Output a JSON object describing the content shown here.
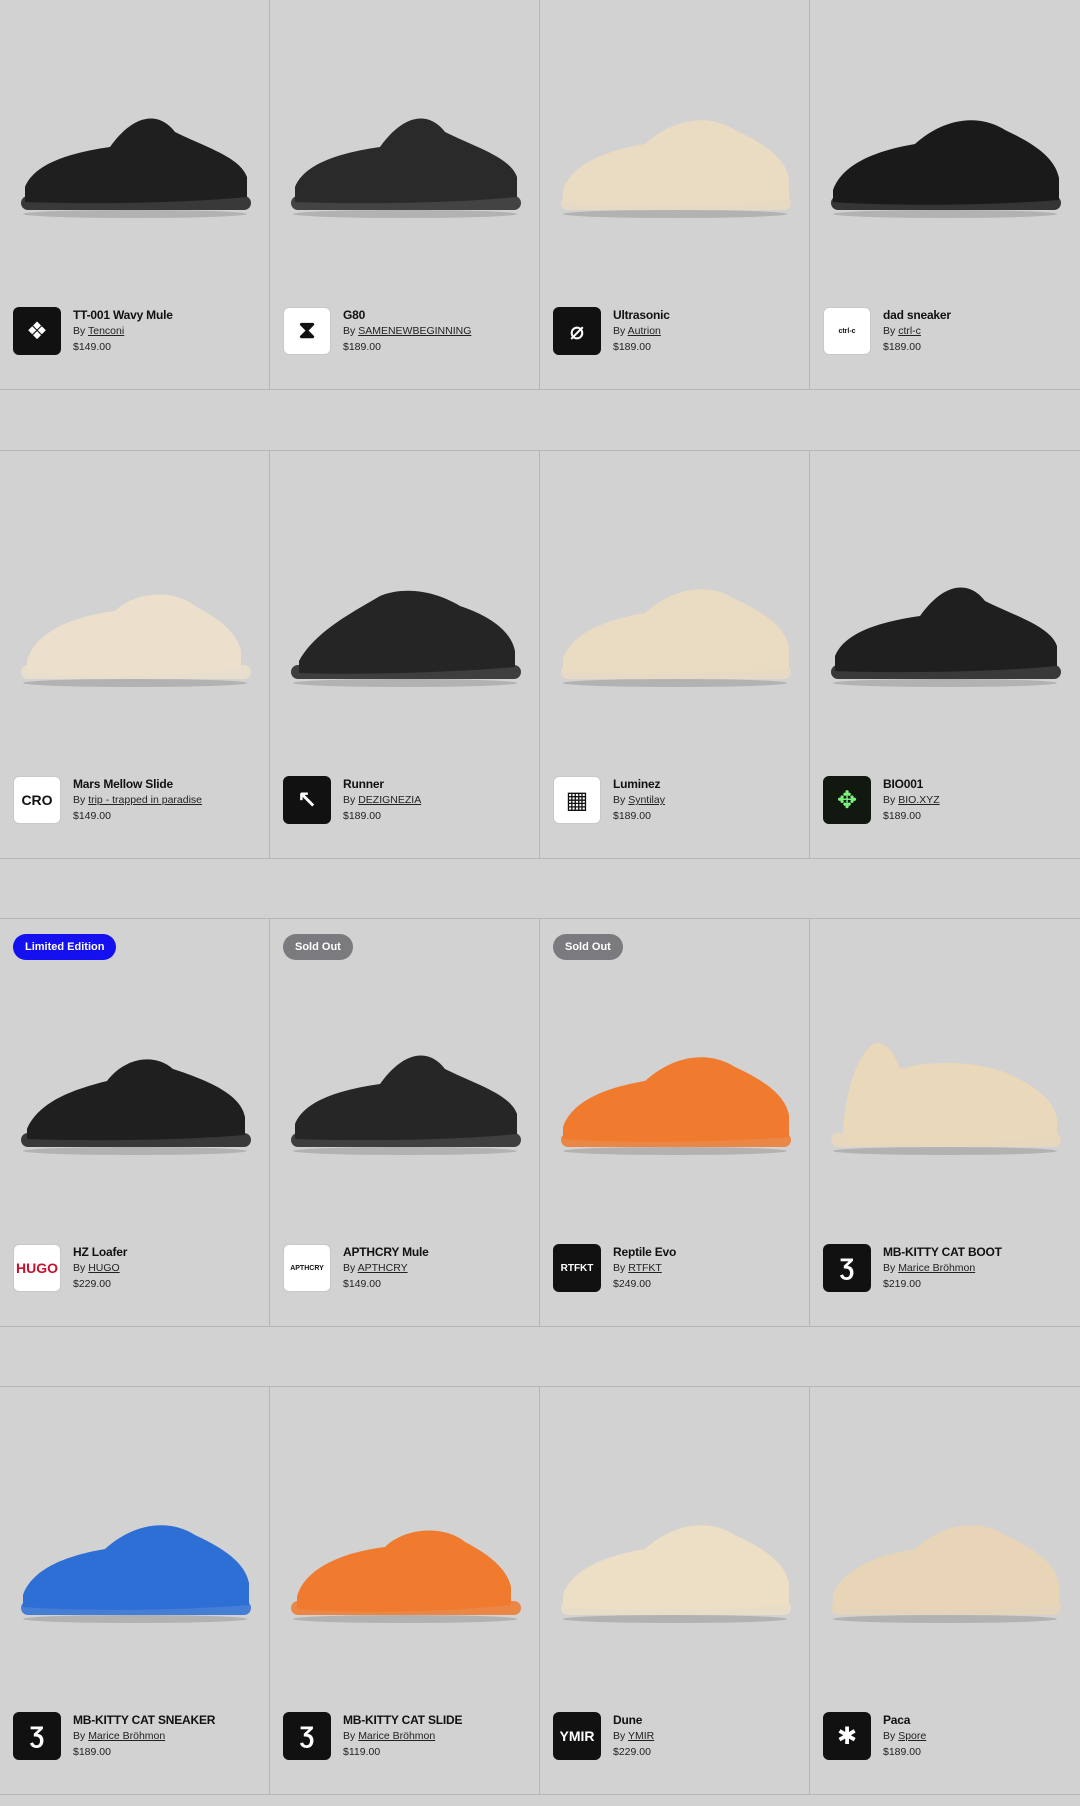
{
  "products": [
    {
      "title": "TT-001 Wavy Mule",
      "by": "By",
      "brand": "Tenconi",
      "price": "$149.00",
      "badge": "",
      "logo_text": "",
      "logo_icon": "tenconi-logo-icon",
      "logo_style": "dark",
      "color": "#1f1f1f",
      "shape": "mule"
    },
    {
      "title": "G80",
      "by": "By",
      "brand": "SAMENEWBEGINNING",
      "price": "$189.00",
      "badge": "",
      "logo_text": "",
      "logo_icon": "hourglass-logo-icon",
      "logo_style": "light",
      "color": "#2a2a2a",
      "shape": "mule"
    },
    {
      "title": "Ultrasonic",
      "by": "By",
      "brand": "Autrion",
      "price": "$189.00",
      "badge": "",
      "logo_text": "",
      "logo_icon": "autrion-logo-icon",
      "logo_style": "dark",
      "color": "#eadcc2",
      "shape": "sneaker"
    },
    {
      "title": "dad sneaker",
      "by": "By",
      "brand": "ctrl-c",
      "price": "$189.00",
      "badge": "",
      "logo_text": "ctrl-c",
      "logo_icon": "ctrl-c-logo-icon",
      "logo_style": "light",
      "color": "#1a1a1a",
      "shape": "sneaker"
    },
    {
      "title": "Mars Mellow Slide",
      "by": "By",
      "brand": "trip - trapped in paradise",
      "price": "$149.00",
      "badge": "",
      "logo_text": "CRO",
      "logo_icon": "cro-logo-icon",
      "logo_style": "light",
      "color": "#ece0cc",
      "shape": "slide"
    },
    {
      "title": "Runner",
      "by": "By",
      "brand": "DEZIGNEZIA",
      "price": "$189.00",
      "badge": "",
      "logo_text": "",
      "logo_icon": "cursor-logo-icon",
      "logo_style": "dark",
      "color": "#252525",
      "shape": "runner"
    },
    {
      "title": "Luminez",
      "by": "By",
      "brand": "Syntilay",
      "price": "$189.00",
      "badge": "",
      "logo_text": "",
      "logo_icon": "syntilay-logo-icon",
      "logo_style": "light",
      "color": "#eadcc2",
      "shape": "sneaker"
    },
    {
      "title": "BIO001",
      "by": "By",
      "brand": "BIO.XYZ",
      "price": "$189.00",
      "badge": "",
      "logo_text": "",
      "logo_icon": "bio-logo-icon",
      "logo_style": "green",
      "color": "#1f1f1f",
      "shape": "mule"
    },
    {
      "title": "HZ Loafer",
      "by": "By",
      "brand": "HUGO",
      "price": "$229.00",
      "badge": "Limited Edition",
      "badge_style": "limited",
      "logo_text": "HUGO",
      "logo_icon": "hugo-logo-icon",
      "logo_style": "light",
      "color": "#1f1f1f",
      "shape": "loafer"
    },
    {
      "title": "APTHCRY Mule",
      "by": "By",
      "brand": "APTHCRY",
      "price": "$149.00",
      "badge": "Sold Out",
      "badge_style": "sold",
      "logo_text": "APTHCRY",
      "logo_icon": "apthcry-logo-icon",
      "logo_style": "light",
      "color": "#262626",
      "shape": "mule"
    },
    {
      "title": "Reptile Evo",
      "by": "By",
      "brand": "RTFKT",
      "price": "$249.00",
      "badge": "Sold Out",
      "badge_style": "sold",
      "logo_text": "RTFKT",
      "logo_icon": "rtfkt-logo-icon",
      "logo_style": "dark",
      "color": "#f07a2e",
      "shape": "sneaker"
    },
    {
      "title": "MB-KITTY CAT BOOT",
      "by": "By",
      "brand": "Marice Bröhmon",
      "price": "$219.00",
      "badge": "",
      "logo_text": "",
      "logo_icon": "mb-logo-icon",
      "logo_style": "dark",
      "color": "#ead8bb",
      "shape": "boot"
    },
    {
      "title": "MB-KITTY CAT SNEAKER",
      "by": "By",
      "brand": "Marice Bröhmon",
      "price": "$189.00",
      "badge": "",
      "logo_text": "",
      "logo_icon": "mb-logo-icon",
      "logo_style": "dark",
      "color": "#2e6fd6",
      "shape": "sneaker"
    },
    {
      "title": "MB-KITTY CAT SLIDE",
      "by": "By",
      "brand": "Marice Bröhmon",
      "price": "$119.00",
      "badge": "",
      "logo_text": "",
      "logo_icon": "mb-logo-icon",
      "logo_style": "dark",
      "color": "#f07a2e",
      "shape": "slide"
    },
    {
      "title": "Dune",
      "by": "By",
      "brand": "YMIR",
      "price": "$229.00",
      "badge": "",
      "logo_text": "YMIR",
      "logo_icon": "ymir-logo-icon",
      "logo_style": "dark",
      "color": "#ecdfc6",
      "shape": "sneaker"
    },
    {
      "title": "Paca",
      "by": "By",
      "brand": "Spore",
      "price": "$189.00",
      "badge": "",
      "logo_text": "",
      "logo_icon": "spore-logo-icon",
      "logo_style": "dark",
      "color": "#e8d5b8",
      "shape": "sneaker"
    }
  ]
}
